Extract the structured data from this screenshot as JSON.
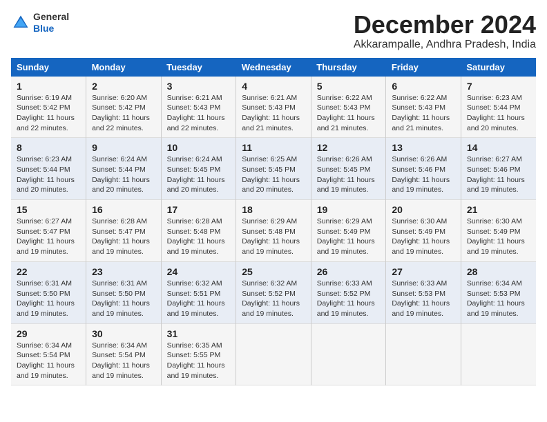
{
  "header": {
    "logo": {
      "general": "General",
      "blue": "Blue"
    },
    "title": "December 2024",
    "location": "Akkarampalle, Andhra Pradesh, India"
  },
  "calendar": {
    "days_of_week": [
      "Sunday",
      "Monday",
      "Tuesday",
      "Wednesday",
      "Thursday",
      "Friday",
      "Saturday"
    ],
    "weeks": [
      [
        null,
        {
          "day": "2",
          "sunrise": "Sunrise: 6:20 AM",
          "sunset": "Sunset: 5:42 PM",
          "daylight": "Daylight: 11 hours and 22 minutes."
        },
        {
          "day": "3",
          "sunrise": "Sunrise: 6:21 AM",
          "sunset": "Sunset: 5:43 PM",
          "daylight": "Daylight: 11 hours and 22 minutes."
        },
        {
          "day": "4",
          "sunrise": "Sunrise: 6:21 AM",
          "sunset": "Sunset: 5:43 PM",
          "daylight": "Daylight: 11 hours and 21 minutes."
        },
        {
          "day": "5",
          "sunrise": "Sunrise: 6:22 AM",
          "sunset": "Sunset: 5:43 PM",
          "daylight": "Daylight: 11 hours and 21 minutes."
        },
        {
          "day": "6",
          "sunrise": "Sunrise: 6:22 AM",
          "sunset": "Sunset: 5:43 PM",
          "daylight": "Daylight: 11 hours and 21 minutes."
        },
        {
          "day": "7",
          "sunrise": "Sunrise: 6:23 AM",
          "sunset": "Sunset: 5:44 PM",
          "daylight": "Daylight: 11 hours and 20 minutes."
        }
      ],
      [
        {
          "day": "1",
          "sunrise": "Sunrise: 6:19 AM",
          "sunset": "Sunset: 5:42 PM",
          "daylight": "Daylight: 11 hours and 22 minutes."
        },
        null,
        null,
        null,
        null,
        null,
        null
      ],
      [
        {
          "day": "8",
          "sunrise": "Sunrise: 6:23 AM",
          "sunset": "Sunset: 5:44 PM",
          "daylight": "Daylight: 11 hours and 20 minutes."
        },
        {
          "day": "9",
          "sunrise": "Sunrise: 6:24 AM",
          "sunset": "Sunset: 5:44 PM",
          "daylight": "Daylight: 11 hours and 20 minutes."
        },
        {
          "day": "10",
          "sunrise": "Sunrise: 6:24 AM",
          "sunset": "Sunset: 5:45 PM",
          "daylight": "Daylight: 11 hours and 20 minutes."
        },
        {
          "day": "11",
          "sunrise": "Sunrise: 6:25 AM",
          "sunset": "Sunset: 5:45 PM",
          "daylight": "Daylight: 11 hours and 20 minutes."
        },
        {
          "day": "12",
          "sunrise": "Sunrise: 6:26 AM",
          "sunset": "Sunset: 5:45 PM",
          "daylight": "Daylight: 11 hours and 19 minutes."
        },
        {
          "day": "13",
          "sunrise": "Sunrise: 6:26 AM",
          "sunset": "Sunset: 5:46 PM",
          "daylight": "Daylight: 11 hours and 19 minutes."
        },
        {
          "day": "14",
          "sunrise": "Sunrise: 6:27 AM",
          "sunset": "Sunset: 5:46 PM",
          "daylight": "Daylight: 11 hours and 19 minutes."
        }
      ],
      [
        {
          "day": "15",
          "sunrise": "Sunrise: 6:27 AM",
          "sunset": "Sunset: 5:47 PM",
          "daylight": "Daylight: 11 hours and 19 minutes."
        },
        {
          "day": "16",
          "sunrise": "Sunrise: 6:28 AM",
          "sunset": "Sunset: 5:47 PM",
          "daylight": "Daylight: 11 hours and 19 minutes."
        },
        {
          "day": "17",
          "sunrise": "Sunrise: 6:28 AM",
          "sunset": "Sunset: 5:48 PM",
          "daylight": "Daylight: 11 hours and 19 minutes."
        },
        {
          "day": "18",
          "sunrise": "Sunrise: 6:29 AM",
          "sunset": "Sunset: 5:48 PM",
          "daylight": "Daylight: 11 hours and 19 minutes."
        },
        {
          "day": "19",
          "sunrise": "Sunrise: 6:29 AM",
          "sunset": "Sunset: 5:49 PM",
          "daylight": "Daylight: 11 hours and 19 minutes."
        },
        {
          "day": "20",
          "sunrise": "Sunrise: 6:30 AM",
          "sunset": "Sunset: 5:49 PM",
          "daylight": "Daylight: 11 hours and 19 minutes."
        },
        {
          "day": "21",
          "sunrise": "Sunrise: 6:30 AM",
          "sunset": "Sunset: 5:49 PM",
          "daylight": "Daylight: 11 hours and 19 minutes."
        }
      ],
      [
        {
          "day": "22",
          "sunrise": "Sunrise: 6:31 AM",
          "sunset": "Sunset: 5:50 PM",
          "daylight": "Daylight: 11 hours and 19 minutes."
        },
        {
          "day": "23",
          "sunrise": "Sunrise: 6:31 AM",
          "sunset": "Sunset: 5:50 PM",
          "daylight": "Daylight: 11 hours and 19 minutes."
        },
        {
          "day": "24",
          "sunrise": "Sunrise: 6:32 AM",
          "sunset": "Sunset: 5:51 PM",
          "daylight": "Daylight: 11 hours and 19 minutes."
        },
        {
          "day": "25",
          "sunrise": "Sunrise: 6:32 AM",
          "sunset": "Sunset: 5:52 PM",
          "daylight": "Daylight: 11 hours and 19 minutes."
        },
        {
          "day": "26",
          "sunrise": "Sunrise: 6:33 AM",
          "sunset": "Sunset: 5:52 PM",
          "daylight": "Daylight: 11 hours and 19 minutes."
        },
        {
          "day": "27",
          "sunrise": "Sunrise: 6:33 AM",
          "sunset": "Sunset: 5:53 PM",
          "daylight": "Daylight: 11 hours and 19 minutes."
        },
        {
          "day": "28",
          "sunrise": "Sunrise: 6:34 AM",
          "sunset": "Sunset: 5:53 PM",
          "daylight": "Daylight: 11 hours and 19 minutes."
        }
      ],
      [
        {
          "day": "29",
          "sunrise": "Sunrise: 6:34 AM",
          "sunset": "Sunset: 5:54 PM",
          "daylight": "Daylight: 11 hours and 19 minutes."
        },
        {
          "day": "30",
          "sunrise": "Sunrise: 6:34 AM",
          "sunset": "Sunset: 5:54 PM",
          "daylight": "Daylight: 11 hours and 19 minutes."
        },
        {
          "day": "31",
          "sunrise": "Sunrise: 6:35 AM",
          "sunset": "Sunset: 5:55 PM",
          "daylight": "Daylight: 11 hours and 19 minutes."
        },
        null,
        null,
        null,
        null
      ]
    ]
  }
}
